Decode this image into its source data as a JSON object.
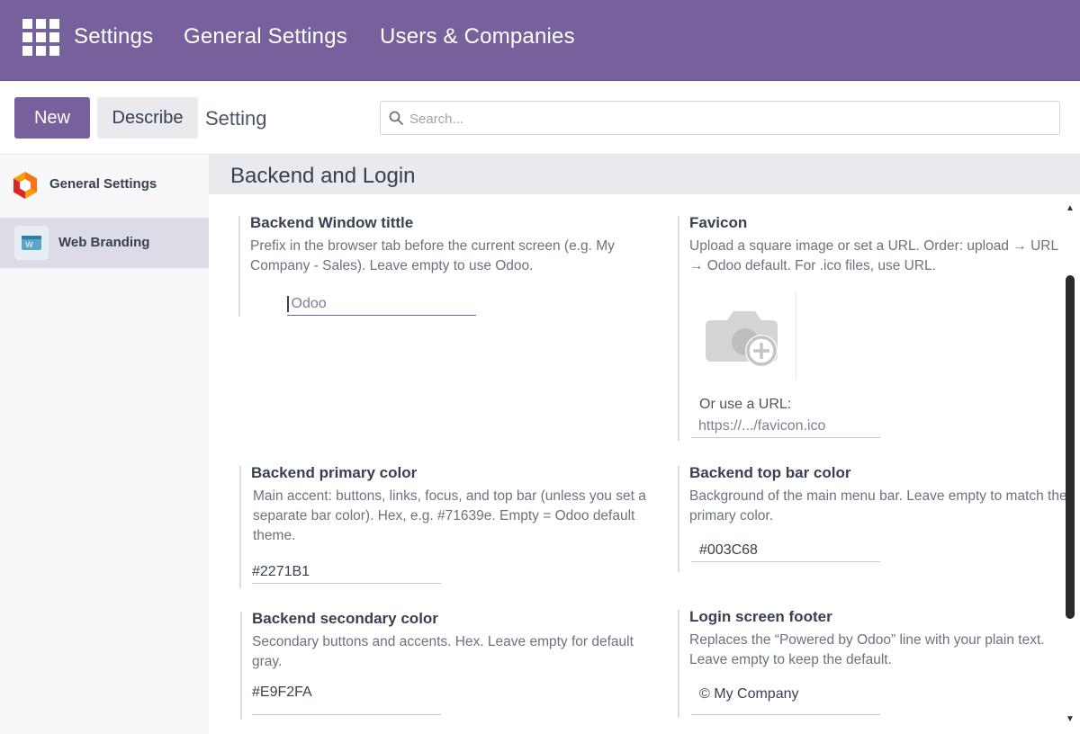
{
  "topbar": {
    "apps_icon": "apps-grid-icon",
    "title": "Settings",
    "menu": [
      "General Settings",
      "Users & Companies"
    ]
  },
  "control_panel": {
    "new_label": "New",
    "describe_label": "Describe",
    "breadcrumb": "Setting",
    "search_placeholder": "Search...",
    "search_icon": "search-icon"
  },
  "sidebar": {
    "items": [
      {
        "label": "General Settings",
        "icon": "odoo-hexagon-icon",
        "active": false
      },
      {
        "label": "Web Branding",
        "icon": "web-branding-icon",
        "active": true
      }
    ]
  },
  "section": {
    "title": "Backend and Login"
  },
  "settings": {
    "window_title": {
      "title": "Backend Window tittle",
      "desc": "Prefix in the browser tab before the current screen (e.g. My Company - Sales). Leave empty to use Odoo.",
      "placeholder": "Odoo"
    },
    "favicon": {
      "title": "Favicon",
      "desc": "Upload a square image or set a URL. Order: upload → URL → Odoo default. For .ico files, use URL.",
      "upload_icon": "camera-add-icon",
      "url_label": "Or use a URL:",
      "url_placeholder": "https://.../favicon.ico"
    },
    "primary_color": {
      "title": "Backend primary color",
      "desc": "Main accent: buttons, links, focus, and top bar (unless you set a separate bar color). Hex, e.g. #71639e. Empty = Odoo default theme.",
      "value": "#2271B1"
    },
    "top_bar_color": {
      "title": "Backend top bar color",
      "desc": "Background of the main menu bar. Leave empty to match the primary color.",
      "value": "#003C68"
    },
    "secondary_color": {
      "title": "Backend secondary color",
      "desc": "Secondary buttons and accents. Hex. Leave empty for default gray.",
      "value": "#E9F2FA"
    },
    "login_footer": {
      "title": "Login screen footer",
      "desc": "Replaces the “Powered by Odoo” line with your plain text. Leave empty to keep the default.",
      "value": "© My Company"
    }
  },
  "colors": {
    "brand": "#77619c",
    "sidebar_active": "#dddbe6",
    "section_header": "#e9eaee"
  }
}
